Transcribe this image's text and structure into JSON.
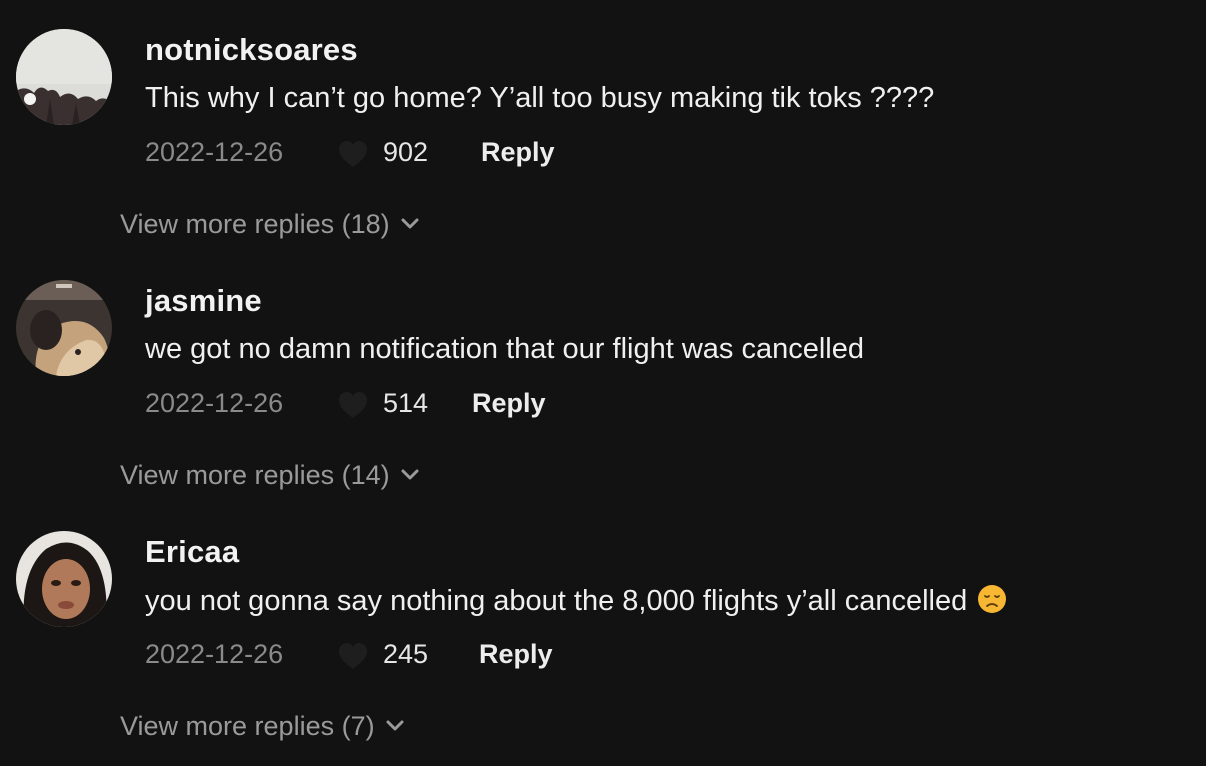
{
  "comments": [
    {
      "username": "notnicksoares",
      "text": "This why I can’t go home? Y’all too busy making tik toks ????",
      "date": "2022-12-26",
      "likes": "902",
      "reply_label": "Reply",
      "view_more": "View more replies (18)",
      "avatar": "avatar-trees-sky"
    },
    {
      "username": "jasmine",
      "text": "we got no damn notification that our flight was cancelled",
      "date": "2022-12-26",
      "likes": "514",
      "reply_label": "Reply",
      "view_more": "View more replies (14)",
      "avatar": "avatar-dog"
    },
    {
      "username": "Ericaa",
      "text": "you not gonna say nothing about the 8,000 flights y’all cancelled",
      "emoji": "disappointed-face-emoji",
      "date": "2022-12-26",
      "likes": "245",
      "reply_label": "Reply",
      "view_more": "View more replies (7)",
      "avatar": "avatar-selfie"
    }
  ],
  "icons": {
    "like": "heart-icon",
    "expand": "chevron-down-icon"
  },
  "colors": {
    "background": "#121212",
    "primary_text": "#f0f0f0",
    "secondary_text": "#8a8a8a"
  }
}
